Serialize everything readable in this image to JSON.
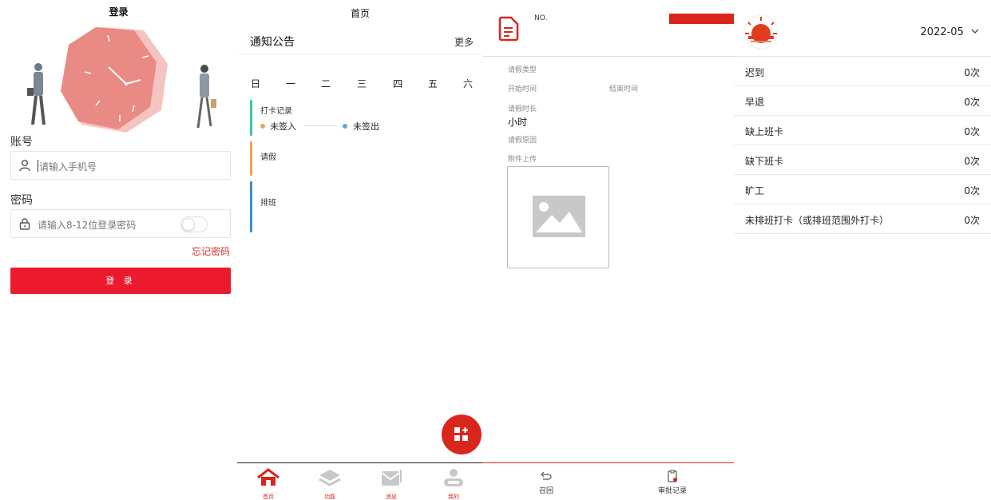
{
  "colors": {
    "accent": "#eb1a2c",
    "brand_red": "#d9261c",
    "attendance_bar": "#3fc3a3",
    "leave_bar": "#f0a05a",
    "shift_bar": "#3d8fd6"
  },
  "login": {
    "title": "登录",
    "account_label": "账号",
    "account_placeholder": "请输入手机号",
    "password_label": "密码",
    "password_placeholder": "请输入8-12位登录密码",
    "forgot": "忘记密码",
    "submit": "登 录"
  },
  "home": {
    "title": "首页",
    "notice": "通知公告",
    "more": "更多",
    "weekdays": [
      "日",
      "一",
      "二",
      "三",
      "四",
      "五",
      "六"
    ],
    "records": {
      "clock_title": "打卡记录",
      "not_in": "未签入",
      "not_out": "未签出",
      "leave": "请假",
      "shift": "排班"
    },
    "tabs": [
      "首页",
      "功能",
      "消息",
      "我的"
    ]
  },
  "leave": {
    "no_label": "NO.",
    "type_label": "请假类型",
    "start_label": "开始时间",
    "end_label": "结束时间",
    "duration_label": "请假时长",
    "duration_value": "小时",
    "reason_label": "请假原因",
    "attachment_label": "附件上传",
    "recall": "召回",
    "approval": "审批记录"
  },
  "stats": {
    "month": "2022-05",
    "rows": [
      {
        "label": "迟到",
        "value": "0次"
      },
      {
        "label": "早退",
        "value": "0次"
      },
      {
        "label": "缺上班卡",
        "value": "0次"
      },
      {
        "label": "缺下班卡",
        "value": "0次"
      },
      {
        "label": "旷工",
        "value": "0次"
      },
      {
        "label": "未排班打卡（或排班范围外打卡）",
        "value": "0次"
      }
    ]
  }
}
